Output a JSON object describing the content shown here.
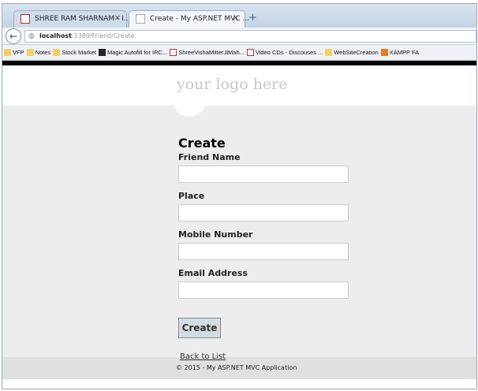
{
  "browser": {
    "tabs": [
      {
        "label": "SHREE RAM SHARNAM - I..."
      },
      {
        "label": "Create - My ASP.NET MVC ..."
      }
    ],
    "url_host": "localhost",
    "url_rest": ":1389/Friend/Create",
    "bookmarks": [
      {
        "label": "VFP",
        "icon": "folder-icon"
      },
      {
        "label": "Notes",
        "icon": "folder-icon"
      },
      {
        "label": "Stock Market",
        "icon": "folder-icon"
      },
      {
        "label": "Magic Autofill for IRC...",
        "icon": "app-icon"
      },
      {
        "label": "ShreeVishaMitterJiMah...",
        "icon": "page-icon"
      },
      {
        "label": "Video CDs - Discouses ...",
        "icon": "page-icon"
      },
      {
        "label": "WebSiteCreation",
        "icon": "folder-icon"
      },
      {
        "label": "XAMPP FA",
        "icon": "xampp-icon"
      }
    ]
  },
  "site": {
    "logo": "your logo here",
    "footer": "© 2015 - My ASP.NET MVC Application"
  },
  "form": {
    "title": "Create",
    "fields": [
      {
        "label": "Friend Name",
        "value": ""
      },
      {
        "label": "Place",
        "value": ""
      },
      {
        "label": "Mobile Number",
        "value": ""
      },
      {
        "label": "Email Address",
        "value": ""
      }
    ],
    "submit": "Create",
    "back_link": "Back to List"
  }
}
